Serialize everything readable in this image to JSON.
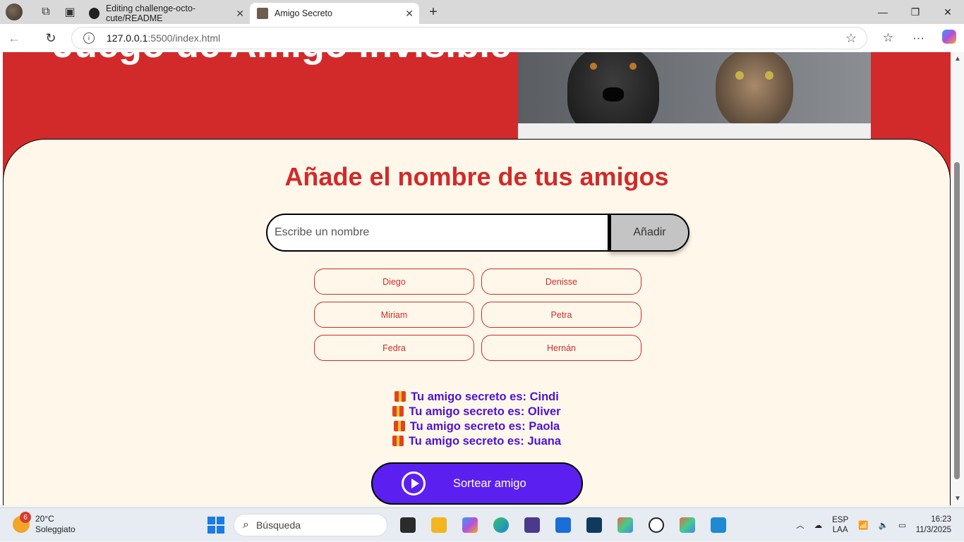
{
  "browser": {
    "tabs": [
      {
        "title": "Editing challenge-octo-cute/README"
      },
      {
        "title": "Amigo Secreto"
      }
    ],
    "url_host": "127.0.0.1",
    "url_path": ":5500/index.html"
  },
  "page": {
    "hero_title": "Juego de Amigo invisible",
    "section_title": "Añade el nombre de tus amigos",
    "name_input_placeholder": "Escribe un nombre",
    "add_button_label": "Añadir",
    "friends": [
      "Diego",
      "Denisse",
      "Miriam",
      "Petra",
      "Fedra",
      "Hernán"
    ],
    "results": [
      "Tu amigo secreto es: Cindi",
      "Tu amigo secreto es: Oliver",
      "Tu amigo secreto es: Paola",
      "Tu amigo secreto es: Juana"
    ],
    "draw_button_label": "Sortear amigo"
  },
  "taskbar": {
    "weather_badge": "6",
    "weather_temp": "20°C",
    "weather_desc": "Soleggiato",
    "search_placeholder": "Búsqueda",
    "lang_primary": "ESP",
    "lang_secondary": "LAA",
    "time": "16:23",
    "date": "11/3/2025"
  },
  "colors": {
    "brand_red": "#d22a2a",
    "accent_purple": "#5b20f0",
    "result_text": "#4b12d9",
    "card_bg": "#fff8ea"
  }
}
